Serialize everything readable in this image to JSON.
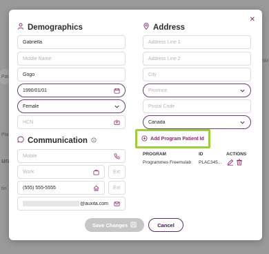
{
  "background": {
    "frag_pat": "Pat",
    "frag_pla": "Pla",
    "frag_risk": "RISM",
    "frag_ura": "ura",
    "frag_tin": "tin"
  },
  "demographics": {
    "title": "Demographics",
    "first_name": "Gabriella",
    "middle_name_placeholder": "Middle Name",
    "last_name": "Gogo",
    "dob": "1990/01/01",
    "gender": "Female",
    "hcn_placeholder": "HCN"
  },
  "communication": {
    "title": "Communication",
    "mobile_placeholder": "Mobile",
    "work_placeholder": "Work",
    "ext_placeholder": "Ext",
    "home_phone": "(555) 555-5555",
    "email_suffix": "@auxita.com"
  },
  "address": {
    "title": "Address",
    "line1_placeholder": "Address Line 1",
    "line2_placeholder": "Address Line 2",
    "city_placeholder": "City",
    "province_placeholder": "Province",
    "postal_placeholder": "Postal Code",
    "country": "Canada"
  },
  "program": {
    "add_label": "Add Program Patient Id",
    "headers": {
      "program": "PROGRAM",
      "id": "ID",
      "actions": "ACTIONS"
    },
    "rows": [
      {
        "program": "Programmes Freemulab",
        "id": "PLAC345..."
      }
    ]
  },
  "footer": {
    "save_label": "Save Changes",
    "cancel_label": "Cancel"
  },
  "colors": {
    "accent": "#8a2a6b",
    "highlight": "#9ccf3a",
    "disabled": "#c6c6c6"
  },
  "icons": [
    "user-icon",
    "map-pin-icon",
    "chat-icon",
    "info-icon",
    "calendar-icon",
    "chevron-down-icon",
    "id-card-icon",
    "phone-icon",
    "briefcase-icon",
    "home-icon",
    "mail-icon",
    "plus-circle-icon",
    "edit-icon",
    "trash-icon",
    "save-icon",
    "close-icon"
  ]
}
